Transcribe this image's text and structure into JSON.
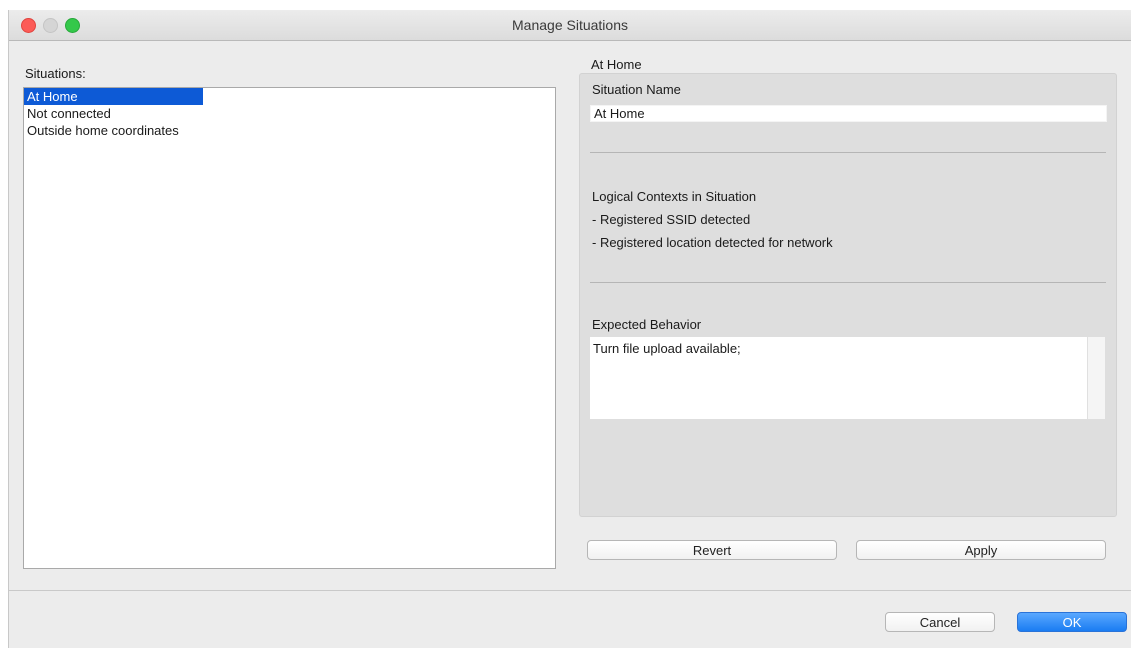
{
  "window": {
    "title": "Manage Situations"
  },
  "situations": {
    "label": "Situations:",
    "items": [
      "At Home",
      "Not connected",
      "Outside home coordinates"
    ],
    "selected": "At Home"
  },
  "detail": {
    "heading": "At Home",
    "name_label": "Situation Name",
    "name_value": "At Home",
    "contexts_label": "Logical Contexts in Situation",
    "contexts": [
      "- Registered SSID detected",
      "- Registered location detected for network"
    ],
    "behavior_label": "Expected Behavior",
    "behavior_value": "Turn file upload available;"
  },
  "buttons": {
    "revert": "Revert",
    "apply": "Apply",
    "cancel": "Cancel",
    "ok": "OK"
  },
  "colors": {
    "selection": "#0d5ad6",
    "primary_button": "#1a7cf2",
    "close": "#fc5b57",
    "zoom": "#34c84a"
  }
}
